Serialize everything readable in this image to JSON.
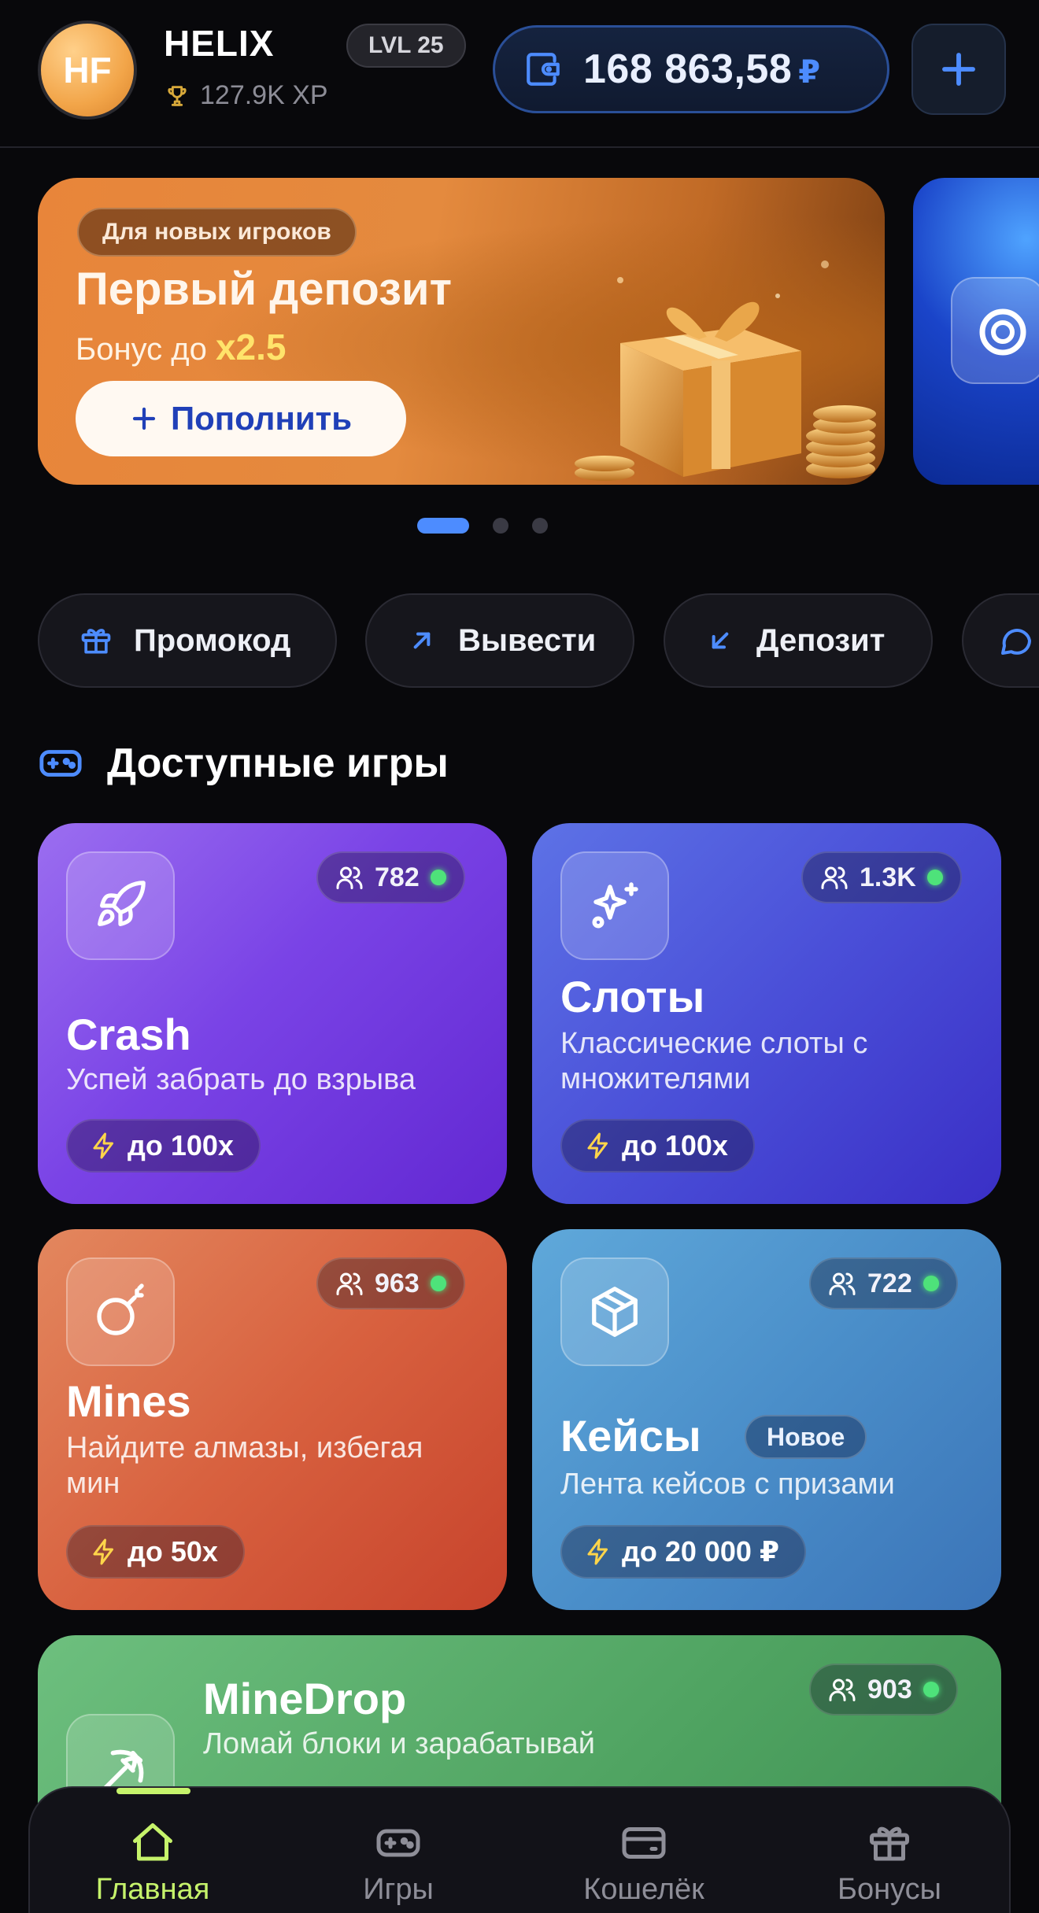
{
  "header": {
    "avatar_initials": "HF",
    "username": "HELIX",
    "level": "LVL 25",
    "xp": "127.9K XP",
    "balance": "168 863,58",
    "currency": "₽"
  },
  "banner": {
    "tag": "Для новых игроков",
    "title": "Первый депозит",
    "subtitle_prefix": "Бонус до",
    "multiplier": "x2.5",
    "button_label": "Пополнить",
    "slide_count": 3,
    "active_slide": 1
  },
  "quick_actions": [
    {
      "label": "Промокод",
      "icon": "gift-icon"
    },
    {
      "label": "Вывести",
      "icon": "arrow-up-right-icon"
    },
    {
      "label": "Депозит",
      "icon": "arrow-down-left-icon"
    }
  ],
  "section": {
    "title": "Доступные игры",
    "icon": "gamepad-icon"
  },
  "games": {
    "crash": {
      "title": "Crash",
      "desc": "Успей забрать до взрыва",
      "online": "782",
      "mult": "до 100x",
      "icon": "rocket-icon"
    },
    "slots": {
      "title": "Слоты",
      "desc": "Классические слоты с множителями",
      "online": "1.3K",
      "mult": "до 100x",
      "icon": "sparkles-icon"
    },
    "mines": {
      "title": "Mines",
      "desc": "Найдите алмазы, избегая мин",
      "online": "963",
      "mult": "до 50x",
      "icon": "bomb-icon"
    },
    "cases": {
      "title": "Кейсы",
      "badge": "Новое",
      "desc": "Лента кейсов с призами",
      "online": "722",
      "mult": "до 20 000 ₽",
      "icon": "box-icon"
    },
    "minedrop": {
      "title": "MineDrop",
      "desc": "Ломай блоки и зарабатывай",
      "online": "903",
      "icon": "pickaxe-icon"
    }
  },
  "nav": {
    "items": [
      {
        "label": "Главная",
        "icon": "home-icon",
        "active": true
      },
      {
        "label": "Игры",
        "icon": "gamepad-icon",
        "active": false
      },
      {
        "label": "Кошелёк",
        "icon": "wallet-icon",
        "active": false
      },
      {
        "label": "Бонусы",
        "icon": "gift-icon",
        "active": false
      }
    ]
  },
  "colors": {
    "accent": "#4d8cff",
    "nav_active": "#c6f36b",
    "online": "#4ee27a",
    "multiplier_highlight": "#ffe36b"
  }
}
